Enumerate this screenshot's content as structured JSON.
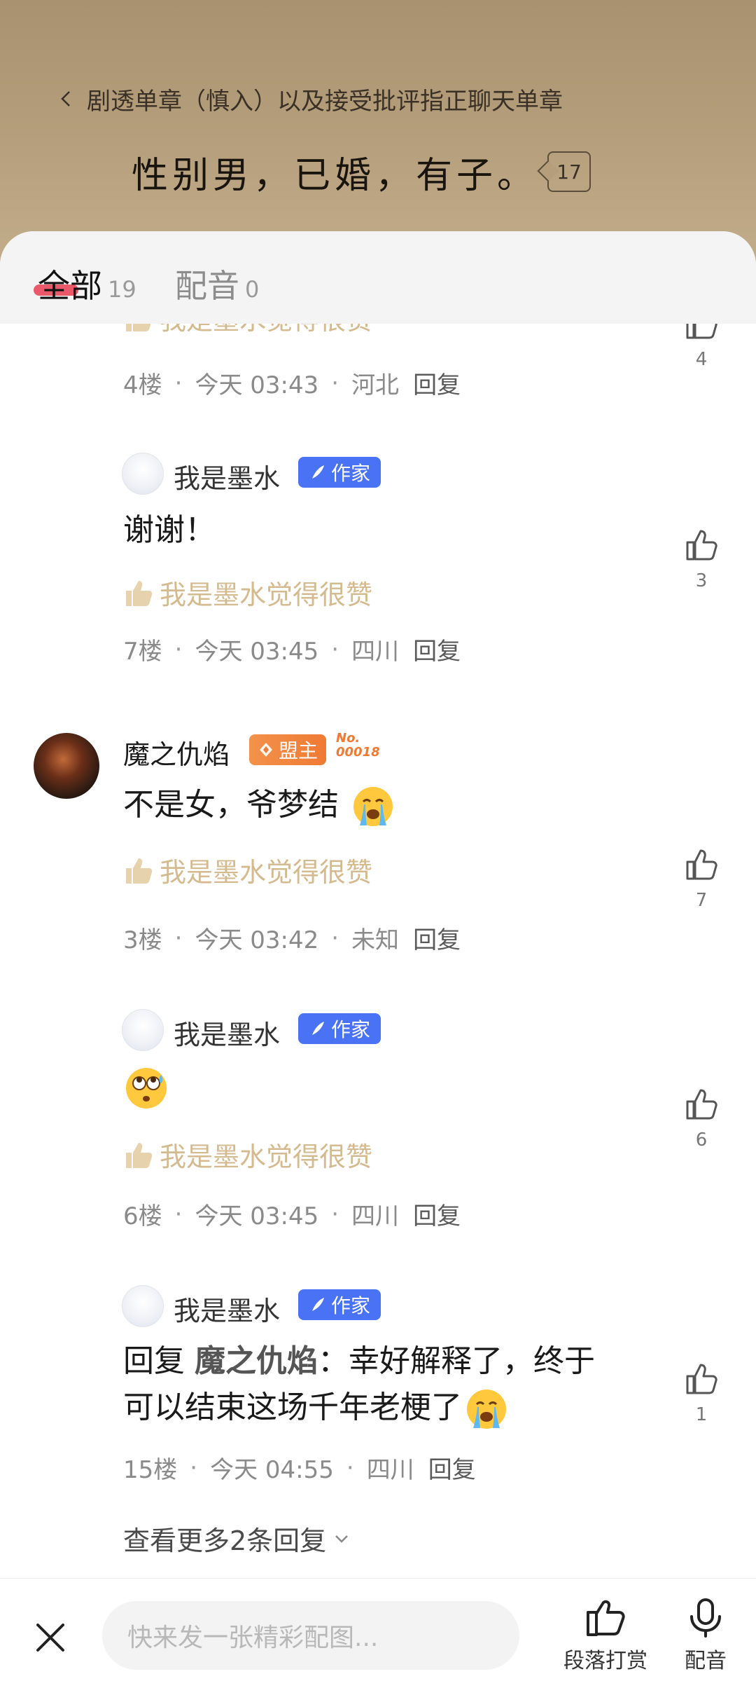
{
  "header": {
    "breadcrumb": "剧透单章（慎入）以及接受批评指正聊天单章",
    "quote": "性别男，已婚，有子。",
    "quote_count": "17"
  },
  "tabs": [
    {
      "label": "全部",
      "count": "19"
    },
    {
      "label": "配音",
      "count": "0"
    }
  ],
  "comments": [
    {
      "praise": "我是墨水觉得很赞",
      "floor": "4楼",
      "time": "今天 03:43",
      "location": "河北",
      "reply": "回复",
      "likes": "4"
    },
    {
      "user": "我是墨水",
      "tag": "作家",
      "text": "谢谢！",
      "praise": "我是墨水觉得很赞",
      "floor": "7楼",
      "time": "今天 03:45",
      "location": "四川",
      "reply": "回复",
      "likes": "3"
    },
    {
      "user": "魔之仇焰",
      "tag": "盟主",
      "rank_no": "No.",
      "rank_num": "00018",
      "text": "不是女，爷梦结",
      "emoji": "crying-face-emoji",
      "praise": "我是墨水觉得很赞",
      "floor": "3楼",
      "time": "今天 03:42",
      "location": "未知",
      "reply": "回复",
      "likes": "7"
    },
    {
      "user": "我是墨水",
      "tag": "作家",
      "emoji": "rolling-eyes-sweat-emoji",
      "praise": "我是墨水觉得很赞",
      "floor": "6楼",
      "time": "今天 03:45",
      "location": "四川",
      "reply": "回复",
      "likes": "6"
    },
    {
      "user": "我是墨水",
      "tag": "作家",
      "reply_prefix": "回复",
      "reply_to": "魔之仇焰",
      "text_line1": "：幸好解释了，终于",
      "text_line2": "可以结束这场千年老梗了",
      "emoji": "crying-face-emoji",
      "floor": "15楼",
      "time": "今天 04:55",
      "location": "四川",
      "reply": "回复",
      "likes": "1"
    }
  ],
  "more_replies": "查看更多2条回复",
  "bottombar": {
    "input_placeholder": "快来发一张精彩配图...",
    "tip_label": "段落打赏",
    "dub_label": "配音"
  },
  "colors": {
    "author_tag": "#4a72f5",
    "leader_tag": "#ef7a34",
    "praise": "#d4bb8f",
    "tab_underline": "#e8485b"
  }
}
